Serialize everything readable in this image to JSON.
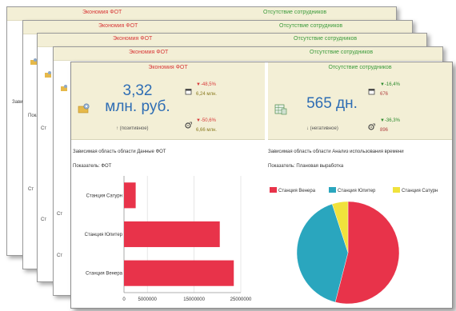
{
  "stack": {
    "payroll_title": "Экономия ФОТ",
    "absence_title": "Отсутствие сотрудников",
    "side_labels": [
      "Зави",
      "Пока",
      "Ст",
      "Ст",
      "Ст"
    ]
  },
  "dashboard": {
    "payroll": {
      "title": "Экономия ФОТ",
      "value": "3,32",
      "unit": "млн. руб.",
      "trend": "↑ (позитивное)",
      "delta1": "▼-48,5%",
      "delta1_value": "6,24 млн.",
      "delta2": "▼-50,6%",
      "delta2_value": "6,66 млн."
    },
    "absence": {
      "title": "Отсутствие сотрудников",
      "value": "565 дн.",
      "trend": "↓ (негативное)",
      "delta1": "▼-16,4%",
      "delta1_value": "676",
      "delta2": "▼-36,3%",
      "delta2_value": "896"
    },
    "left_section": {
      "caption": "Зависимая область области Данные ФОТ",
      "indicator": "Показатель:  ФОТ"
    },
    "right_section": {
      "caption": "Зависимая область области Анализ использования времени",
      "indicator": "Показатель:  Плановая выработка"
    }
  },
  "chart_data": [
    {
      "type": "bar",
      "orientation": "horizontal",
      "categories": [
        "Станция Сатурн",
        "Станция Юпитер",
        "Станция Венера"
      ],
      "values": [
        2500000,
        20500000,
        23500000
      ],
      "xlim": [
        0,
        25000000
      ],
      "xticks": [
        "0",
        "5000000",
        "15000000",
        "25000000"
      ],
      "xtick_values": [
        0,
        5000000,
        15000000,
        25000000
      ],
      "color": "#e8334a",
      "grid": true
    },
    {
      "type": "pie",
      "labels": [
        "Станция Венера",
        "Станция Юпитер",
        "Станция Сатурн"
      ],
      "values": [
        54,
        41,
        5
      ],
      "colors": [
        "#e8334a",
        "#2aa6be",
        "#f0e23c"
      ],
      "legend": "top"
    }
  ]
}
